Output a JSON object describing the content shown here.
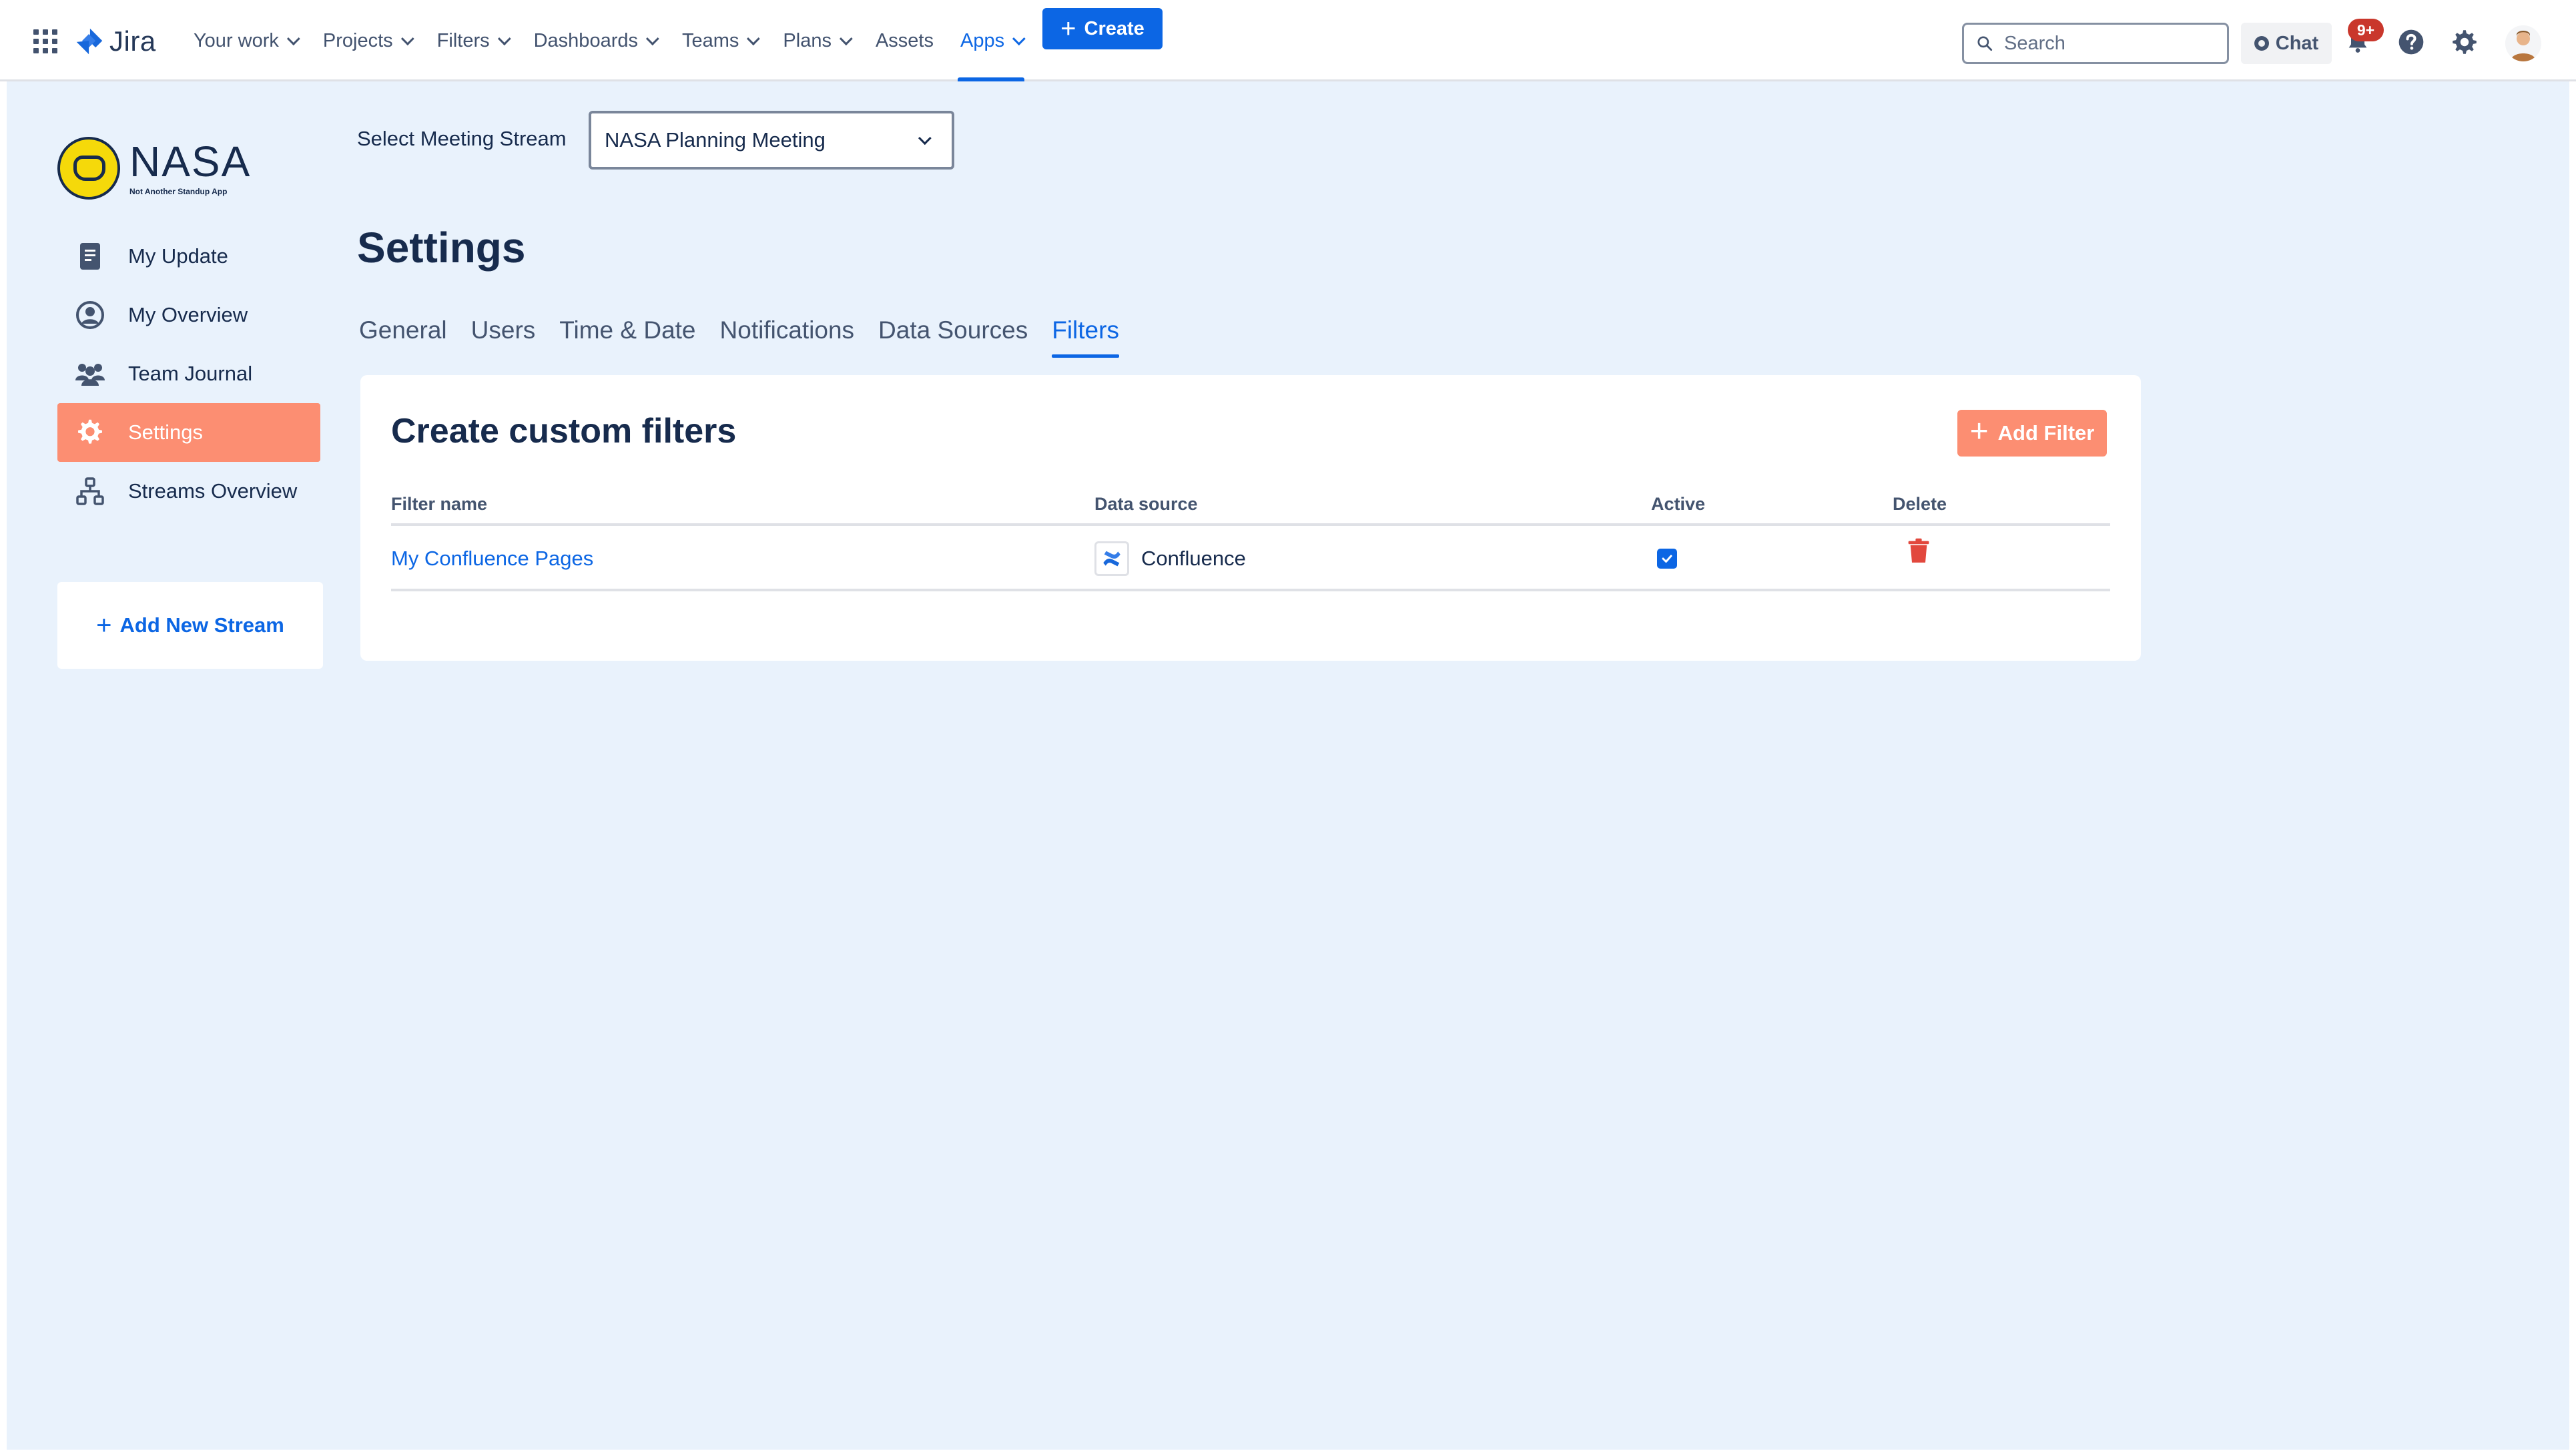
{
  "topnav": {
    "app_name": "Jira",
    "items": [
      {
        "label": "Your work",
        "dropdown": true,
        "active": false
      },
      {
        "label": "Projects",
        "dropdown": true,
        "active": false
      },
      {
        "label": "Filters",
        "dropdown": true,
        "active": false
      },
      {
        "label": "Dashboards",
        "dropdown": true,
        "active": false
      },
      {
        "label": "Teams",
        "dropdown": true,
        "active": false
      },
      {
        "label": "Plans",
        "dropdown": true,
        "active": false
      },
      {
        "label": "Assets",
        "dropdown": false,
        "active": false
      },
      {
        "label": "Apps",
        "dropdown": true,
        "active": true
      }
    ],
    "create_label": "Create",
    "search_placeholder": "Search",
    "chat_label": "Chat",
    "notification_badge": "9+"
  },
  "sidebar": {
    "brand_name": "NASA",
    "brand_tagline": "Not Another Standup App",
    "items": [
      {
        "label": "My Update",
        "icon": "document-icon",
        "active": false
      },
      {
        "label": "My Overview",
        "icon": "user-circle-icon",
        "active": false
      },
      {
        "label": "Team Journal",
        "icon": "people-icon",
        "active": false
      },
      {
        "label": "Settings",
        "icon": "gear-icon",
        "active": true
      },
      {
        "label": "Streams Overview",
        "icon": "hierarchy-icon",
        "active": false
      }
    ],
    "add_stream_label": "Add New Stream"
  },
  "main": {
    "stream_label": "Select Meeting Stream",
    "stream_value": "NASA Planning Meeting",
    "page_title": "Settings",
    "tabs": [
      {
        "label": "General",
        "active": false
      },
      {
        "label": "Users",
        "active": false
      },
      {
        "label": "Time & Date",
        "active": false
      },
      {
        "label": "Notifications",
        "active": false
      },
      {
        "label": "Data Sources",
        "active": false
      },
      {
        "label": "Filters",
        "active": true
      }
    ],
    "panel": {
      "title": "Create custom filters",
      "add_filter_label": "Add Filter",
      "columns": [
        "Filter name",
        "Data source",
        "Active",
        "Delete"
      ],
      "rows": [
        {
          "name": "My Confluence Pages",
          "source": "Confluence",
          "active": true
        }
      ]
    }
  },
  "colors": {
    "accent": "#0c66e4",
    "brand_coral": "#fc8e72",
    "page_bg": "#e9f2fc",
    "delete_red": "#e2483d"
  }
}
